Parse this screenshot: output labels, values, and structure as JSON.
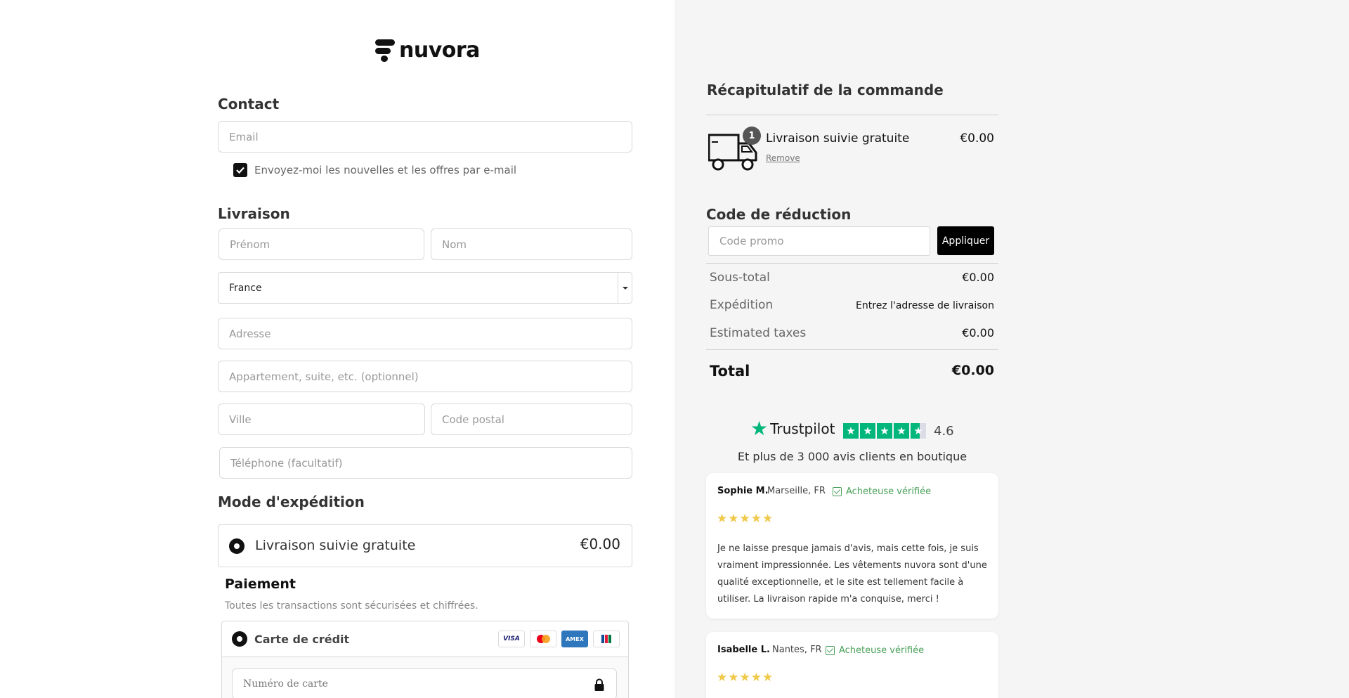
{
  "brand": {
    "name": "nuvora"
  },
  "contact": {
    "title": "Contact",
    "email_placeholder": "Email",
    "newsletter_label": "Envoyez-moi les nouvelles et les offres par e-mail",
    "newsletter_checked": true
  },
  "delivery": {
    "title": "Livraison",
    "first_name_placeholder": "Prénom",
    "last_name_placeholder": "Nom",
    "country_value": "France",
    "address_placeholder": "Adresse",
    "apartment_placeholder": "Appartement, suite, etc. (optionnel)",
    "city_placeholder": "Ville",
    "postal_placeholder": "Code postal",
    "phone_placeholder": "Téléphone (facultatif)"
  },
  "shipping_method": {
    "title": "Mode d'expédition",
    "option_label": "Livraison suivie gratuite",
    "option_price": "€0.00"
  },
  "payment": {
    "title": "Paiement",
    "subtitle": "Toutes les transactions sont sécurisées et chiffrées.",
    "method_label": "Carte de crédit",
    "card_brands": [
      "VISA",
      "mastercard",
      "AMEX",
      "JCB"
    ],
    "card_number_placeholder": "Numéro de carte"
  },
  "summary": {
    "title": "Récapitulatif de la commande",
    "item": {
      "name": "Livraison suivie gratuite",
      "price": "€0.00",
      "qty": "1",
      "remove_label": "Remove"
    },
    "discount_title": "Code de réduction",
    "promo_placeholder": "Code promo",
    "apply_label": "Appliquer",
    "subtotal_label": "Sous-total",
    "subtotal_value": "€0.00",
    "shipping_label": "Expédition",
    "shipping_value": "Entrez l'adresse de livraison",
    "taxes_label": "Estimated taxes",
    "taxes_value": "€0.00",
    "total_label": "Total",
    "total_value": "€0.00"
  },
  "trustpilot": {
    "brand": "Trustpilot",
    "rating": "4.6",
    "caption": "Et plus de 3 000 avis clients en boutique"
  },
  "reviews": [
    {
      "name": "Sophie M.",
      "location": "Marseille, FR",
      "verified_label": "Acheteuse vérifiée",
      "stars": 5,
      "text": "Je ne laisse presque jamais d'avis, mais cette fois, je suis vraiment impressionnée. Les vêtements nuvora sont d'une qualité exceptionnelle, et le site est tellement facile à utiliser. La livraison rapide m'a conquise, merci !"
    },
    {
      "name": "Isabelle L.",
      "location": "Nantes, FR",
      "verified_label": "Acheteuse vérifiée",
      "stars": 5
    }
  ],
  "colors": {
    "accent": "#000000",
    "trustpilot_green": "#00b67a",
    "star_gold": "#f0c94a",
    "verified_green": "#4aa05a",
    "summary_bg": "#f5f5f5"
  }
}
